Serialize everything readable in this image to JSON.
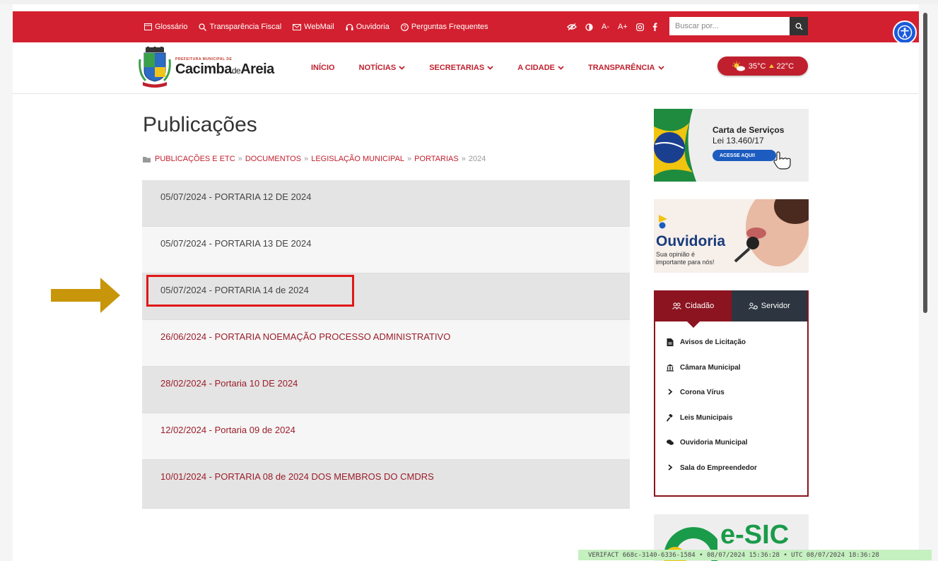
{
  "topbar": {
    "links": [
      {
        "label": "Glossário",
        "icon": "book-icon"
      },
      {
        "label": "Transparência Fiscal",
        "icon": "search-icon"
      },
      {
        "label": "WebMail",
        "icon": "mail-icon"
      },
      {
        "label": "Ouvidoria",
        "icon": "headset-icon"
      },
      {
        "label": "Perguntas Frequentes",
        "icon": "question-icon"
      }
    ],
    "tools": {
      "decrease_font": "A-",
      "increase_font": "A+"
    },
    "search_placeholder": "Buscar por..."
  },
  "logo": {
    "small": "PREFEITURA MUNICIPAL DE",
    "name_a": "Cacimba",
    "name_de": "de",
    "name_b": "Areia"
  },
  "nav": [
    "INÍCIO",
    "NOTÍCIAS",
    "SECRETARIAS",
    "A CIDADE",
    "TRANSPARÊNCIA"
  ],
  "weather": {
    "max": "35°C",
    "min": "22°C"
  },
  "page": {
    "title": "Publicações",
    "breadcrumb": [
      "PUBLICAÇÕES E ETC",
      "DOCUMENTOS",
      "LEGISLAÇÃO MUNICIPAL",
      "PORTARIAS",
      "2024"
    ],
    "breadcrumb_sep": "»"
  },
  "publications": [
    "05/07/2024 - PORTARIA 12 DE 2024",
    "05/07/2024 - PORTARIA 13 DE 2024",
    "05/07/2024 - PORTARIA 14 de 2024",
    "26/06/2024 - PORTARIA NOEMAÇÃO PROCESSO ADMINISTRATIVO",
    "28/02/2024 - Portaria 10 DE 2024",
    "12/02/2024 - Portaria 09 de 2024",
    "10/01/2024 - PORTARIA 08 de 2024 DOS MEMBROS DO CMDRS"
  ],
  "sidebar": {
    "carta": {
      "title": "Carta de Serviços",
      "subtitle": "Lei 13.460/17",
      "button": "ACESSE AQUI!"
    },
    "ouvidoria": {
      "title": "Ouvidoria",
      "line1": "Sua opinião é",
      "line2": "importante para nós!"
    },
    "tabs": [
      "Cidadão",
      "Servidor"
    ],
    "services": [
      {
        "label": "Avisos de Licitação",
        "icon": "file-icon"
      },
      {
        "label": "Câmara Municipal",
        "icon": "building-icon"
      },
      {
        "label": "Corona Vírus",
        "icon": "chevron-right-icon"
      },
      {
        "label": "Leis Municipais",
        "icon": "gavel-icon"
      },
      {
        "label": "Ouvidoria Municipal",
        "icon": "comments-icon"
      },
      {
        "label": "Sala do Empreendedor",
        "icon": "chevron-right-icon"
      }
    ],
    "esic": "e-SIC"
  },
  "watermark": "VERIFACT 668c-3140-6336-1584 • 08/07/2024 15:36:28 • UTC 08/07/2024 18:36:28",
  "colors": {
    "brand_red": "#d32030",
    "dark_red": "#8b1420",
    "annotation_arrow": "#c8960a",
    "highlight": "#e01818"
  }
}
